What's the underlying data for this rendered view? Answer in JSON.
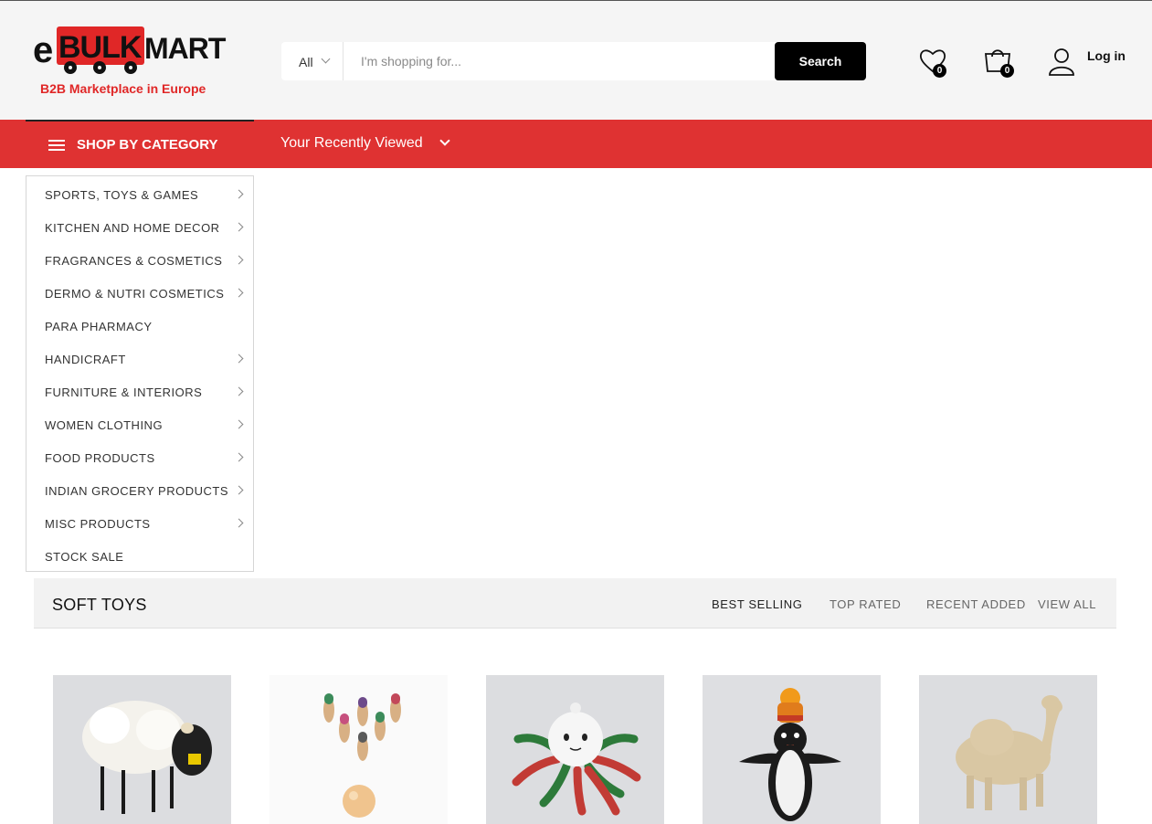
{
  "brand": {
    "name_e": "e",
    "name_bulk": "BULK",
    "name_mart": "MART",
    "tagline": "B2B Marketplace in Europe",
    "accent_color": "#df3232"
  },
  "search": {
    "category": "All",
    "placeholder": "I'm shopping for...",
    "button_label": "Search"
  },
  "header_icons": {
    "wishlist_icon": "heart-icon",
    "wishlist_count": "0",
    "cart_icon": "shopping-bag-icon",
    "cart_count": "0",
    "account_icon": "user-icon",
    "login_label": "Log in"
  },
  "navbar": {
    "shop_by_category": "SHOP BY CATEGORY",
    "recently_viewed": "Your Recently Viewed"
  },
  "categories": [
    {
      "label": "SPORTS, TOYS & GAMES",
      "has_sub": true
    },
    {
      "label": "KITCHEN AND HOME DECOR",
      "has_sub": true
    },
    {
      "label": "FRAGRANCES & COSMETICS",
      "has_sub": true
    },
    {
      "label": "DERMO & NUTRI COSMETICS",
      "has_sub": true
    },
    {
      "label": "PARA PHARMACY",
      "has_sub": false
    },
    {
      "label": "HANDICRAFT",
      "has_sub": true
    },
    {
      "label": "FURNITURE & INTERIORS",
      "has_sub": true
    },
    {
      "label": "WOMEN CLOTHING",
      "has_sub": true
    },
    {
      "label": "FOOD PRODUCTS",
      "has_sub": true
    },
    {
      "label": "INDIAN GROCERY PRODUCTS",
      "has_sub": true
    },
    {
      "label": "MISC PRODUCTS",
      "has_sub": true
    },
    {
      "label": "STOCK SALE",
      "has_sub": false
    }
  ],
  "section": {
    "title": "SOFT TOYS",
    "tabs": [
      "BEST SELLING",
      "TOP RATED",
      "RECENT ADDED",
      "VIEW ALL"
    ],
    "active_tab": "BEST SELLING"
  },
  "products": [
    {
      "image": "felt-sheep-toy"
    },
    {
      "image": "wooden-bowling-set"
    },
    {
      "image": "crochet-octopus-toy"
    },
    {
      "image": "knitted-penguin-toy"
    },
    {
      "image": "felt-camel-toy"
    }
  ]
}
